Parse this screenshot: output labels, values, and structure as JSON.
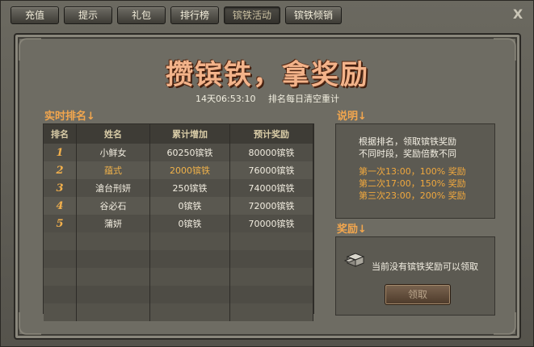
{
  "tabs": [
    {
      "label": "充值",
      "active": false
    },
    {
      "label": "提示",
      "active": false
    },
    {
      "label": "礼包",
      "active": false
    },
    {
      "label": "排行榜",
      "active": false
    },
    {
      "label": "镔铁活动",
      "active": true
    },
    {
      "label": "镔铁倾销",
      "active": false
    }
  ],
  "close_label": "X",
  "title": "攒镔铁，拿奖励",
  "countdown": "14天06:53:10",
  "reset_note": "排名每日清空重计",
  "rank_section": {
    "label": "实时排名↓",
    "headers": [
      "排名",
      "姓名",
      "累计增加",
      "预计奖励"
    ],
    "rows": [
      {
        "rank": "1",
        "name": "小鲜女",
        "total": "60250镔铁",
        "reward": "80000镔铁"
      },
      {
        "rank": "2",
        "name": "蕴式",
        "total": "2000镔铁",
        "reward": "76000镔铁"
      },
      {
        "rank": "3",
        "name": "滄台刑妍",
        "total": "250镔铁",
        "reward": "74000镔铁"
      },
      {
        "rank": "4",
        "name": "谷必石",
        "total": "0镔铁",
        "reward": "72000镔铁"
      },
      {
        "rank": "5",
        "name": "蒲妍",
        "total": "0镔铁",
        "reward": "70000镔铁"
      }
    ]
  },
  "desc_section": {
    "label": "说明↓",
    "line1": "根据排名，领取镔铁奖励",
    "line2": "不同时段，奖励倍数不同",
    "line3": "第一次13:00，100% 奖励",
    "line4": "第二次17:00，150% 奖励",
    "line5": "第三次23:00，200% 奖励"
  },
  "reward_section": {
    "label": "奖励↓",
    "message": "当前没有镔铁奖励可以领取",
    "claim_label": "领取",
    "icon": "iron-ingot-icon"
  },
  "colors": {
    "accent_orange": "#f2a64e",
    "title_peach": "#f3b38a",
    "panel_bg": "#6e6c63"
  }
}
